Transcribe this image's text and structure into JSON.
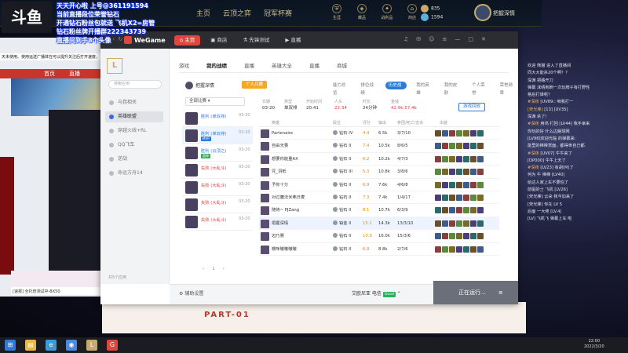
{
  "overlay": {
    "logo": "斗鱼",
    "lines": [
      "天天开心啦 上号@361191594",
      "当前直播段位荣誉钻石",
      "开通钻石粉丝包就送 飞机X2=房管",
      "钻石粉丝牌开播群222343739",
      "直播间到手8个头像"
    ]
  },
  "lol_client": {
    "nav": [
      "主页",
      "云顶之弈",
      "冠军杯赛"
    ],
    "icons": [
      {
        "icon": "shield-icon",
        "label": "生涯"
      },
      {
        "icon": "bag-icon",
        "label": "藏品"
      },
      {
        "icon": "loot-icon",
        "label": "战利品"
      },
      {
        "icon": "store-icon",
        "label": "商店"
      }
    ],
    "currency": {
      "blue_essence": "835",
      "rp": "1594"
    },
    "profile_name": "把握深情"
  },
  "browser": {
    "notice": "天未使用。使用运送广播体在可以提升关注后打开速度。",
    "tab1": "首页",
    "tab2": "直播",
    "footer": "[速报] 全托管测试中-BX50"
  },
  "poster_text": "PART-01",
  "right_chat": [
    {
      "u": "",
      "t": "欢迎 熊猫 进入了直播间"
    },
    {
      "u": "",
      "t": "同大大能杀20个啊？？"
    },
    {
      "u": "",
      "t": "深渊 把路开刀"
    },
    {
      "u": "",
      "t": "弹幕 沫晴到刷一次玩牌子有打野性"
    },
    {
      "u": "",
      "t": "格后打谁呢？"
    },
    {
      "u": "#深夜 ",
      "t": "[UV89:: 咱我打一"
    },
    {
      "u": "[荧光棒] ",
      "t": "[13] [UV35]"
    },
    {
      "u": "",
      "t": "深渊 杀了！"
    },
    {
      "u": "#深夜 ",
      "t": "用鸡 打回 [LV44] 我手拿来"
    },
    {
      "u": "",
      "t": "你玩的好 什么边路球网"
    },
    {
      "u": "",
      "t": "[LV98]欢迎光临 的弹幕来:"
    },
    {
      "u": "",
      "t": "能里的棒棒赏面，都得世自己都."
    },
    {
      "u": "#深夜 ",
      "t": "[UV07] 牛牛来了"
    },
    {
      "u": "",
      "t": "[DP000] 牛牛上天了"
    },
    {
      "u": "#深夜 ",
      "t": "[LV23] 有胡(M)了"
    },
    {
      "u": "",
      "t": "何为 牛 棒棒 [LV40]"
    },
    {
      "u": "",
      "t": "给达人家上车不要怕了"
    },
    {
      "u": "",
      "t": ""
    },
    {
      "u": "",
      "t": "前驱的士 飞机 [LV26]"
    },
    {
      "u": "",
      "t": "[荧光棒] 云朵 我今加来了"
    },
    {
      "u": "",
      "t": "[荧光棒] 你在 LV 5"
    },
    {
      "u": "",
      "t": "后面 一大佬 [LV.4]"
    },
    {
      "u": "",
      "t": "[LV] 飞机飞 弹幕上车 啦"
    }
  ],
  "wegame": {
    "logo": "WeGame",
    "nav": [
      {
        "icon": "home-icon",
        "label": "主页",
        "active": true
      },
      {
        "icon": "store-icon",
        "label": "商店",
        "active": false
      },
      {
        "icon": "flask-icon",
        "label": "先锋测试",
        "active": false
      },
      {
        "icon": "play-icon",
        "label": "直播",
        "active": false
      }
    ],
    "sidebar": {
      "search_placeholder": "搜索应用",
      "items": [
        {
          "label": "与我相关",
          "active": false
        },
        {
          "label": "英雄联盟",
          "active": true
        },
        {
          "label": "穿越火线+RL",
          "active": false
        },
        {
          "label": "QQ飞车",
          "active": false
        },
        {
          "label": "逆战",
          "active": false
        },
        {
          "label": "命运方舟14",
          "active": false
        }
      ],
      "footer": "共5个应用"
    },
    "topnav": [
      {
        "label": "游戏",
        "active": false
      },
      {
        "label": "我的战绩",
        "active": true
      },
      {
        "label": "直播",
        "active": false
      },
      {
        "label": "英雄大全",
        "active": false
      },
      {
        "label": "直播",
        "active": false
      },
      {
        "label": "商城",
        "active": false
      }
    ],
    "summoner": "把握深情",
    "rank_tag": "个人月赛",
    "subtabs": [
      {
        "label": "能力总览",
        "active": false
      },
      {
        "label": "排位战绩",
        "active": false
      },
      {
        "label": "历史战绩",
        "active": true
      },
      {
        "label": "我的英雄",
        "active": false
      },
      {
        "label": "我的皮肤",
        "active": false
      },
      {
        "label": "个人荣誉",
        "active": false
      },
      {
        "label": "荣誉勋章",
        "active": false
      }
    ],
    "filter": "全部比赛",
    "matches": [
      {
        "result": "胜利 (单双排)",
        "type": "win",
        "date": "03-20",
        "badge": "",
        "active": false
      },
      {
        "result": "胜利 (单双排)",
        "type": "win",
        "date": "03-20",
        "badge": "MVP",
        "active": true
      },
      {
        "result": "胜利 (云顶之)",
        "type": "win",
        "date": "03-20",
        "badge": "超神",
        "active": false
      },
      {
        "result": "失败 (大乱斗)",
        "type": "loss",
        "date": "03-20",
        "badge": "",
        "active": false
      },
      {
        "result": "失败 (大乱斗)",
        "type": "loss",
        "date": "03-20",
        "badge": "",
        "active": false
      },
      {
        "result": "失败 (大乱斗)",
        "type": "loss",
        "date": "03-20",
        "badge": "",
        "active": false
      },
      {
        "result": "失败 (大乱斗)",
        "type": "loss",
        "date": "03-20",
        "badge": "",
        "active": false
      }
    ],
    "pager": [
      "‹",
      "1",
      "›"
    ],
    "detail_head": [
      {
        "label": "日期",
        "value": "03-20"
      },
      {
        "label": "类型",
        "value": "单双排"
      },
      {
        "label": "开始时间",
        "value": "20:41"
      },
      {
        "label": "人头",
        "value": "22:34",
        "red": true
      },
      {
        "label": "时长",
        "value": "24分钟"
      },
      {
        "label": "金钱",
        "value": "42.9k:57.4k",
        "red": true
      }
    ],
    "detail_button": "游戏回放",
    "table_headers": [
      "英雄",
      "段位",
      "评分",
      "输出",
      "参团/死亡/击杀",
      "出装"
    ],
    "players": [
      {
        "name": "Partenaire",
        "rank": "钻石 IV",
        "score": "4.4",
        "dmg": "6.5k",
        "kda": "3/7/10",
        "self": false
      },
      {
        "name": "自由无畏",
        "rank": "钻石 II",
        "score": "7.4",
        "dmg": "10.5k",
        "kda": "8/6/5",
        "self": false
      },
      {
        "name": "想要你能量AX",
        "rank": "钻石 II",
        "score": "6.2",
        "dmg": "10.2k",
        "kda": "4/7/3",
        "self": false
      },
      {
        "name": "咒_羽柢",
        "rank": "钻石 III",
        "score": "5.3",
        "dmg": "10.8k",
        "kda": "3/8/6",
        "self": false
      },
      {
        "name": "予你十分",
        "rank": "钻石 II",
        "score": "6.9",
        "dmg": "7.6k",
        "kda": "4/6/8",
        "self": false
      },
      {
        "name": "对过魔法米弗日麦",
        "rank": "钻石 II",
        "score": "7.3",
        "dmg": "7.4k",
        "kda": "1/4/17",
        "self": false
      },
      {
        "name": "随侍~ PJZang",
        "rank": "钻石 II",
        "score": "8.1",
        "dmg": "10.7k",
        "kda": "6/3/9",
        "self": false
      },
      {
        "name": "把握深情",
        "rank": "铂金 II",
        "score": "15.1",
        "dmg": "14.3k",
        "kda": "13/3/10",
        "self": true
      },
      {
        "name": "迈乃赛",
        "rank": "钻石 II",
        "score": "10.9",
        "dmg": "16.0k",
        "kda": "15/3/6",
        "self": false
      },
      {
        "name": "樱咪嗷嗷嗷嗷",
        "rank": "钻石 II",
        "score": "6.8",
        "dmg": "8.8k",
        "kda": "2/7/6",
        "self": false
      }
    ],
    "bottom": {
      "settings": "辅助设置",
      "server": "艾欧尼亚 电信",
      "latency": "Good",
      "running": "正在运行..."
    }
  },
  "taskbar": {
    "apps": [
      {
        "icon": "windows-icon",
        "color": "#2f7ad9"
      },
      {
        "icon": "folder-icon",
        "color": "#e9b84a"
      },
      {
        "icon": "edge-icon",
        "color": "#3a9bd8"
      },
      {
        "icon": "chrome-icon",
        "color": "#4a8ad9"
      },
      {
        "icon": "lol-icon",
        "color": "#c8aa6e"
      },
      {
        "icon": "wegame-icon",
        "color": "#e0473c"
      }
    ],
    "time": "22:00",
    "date": "2022/3/20"
  }
}
